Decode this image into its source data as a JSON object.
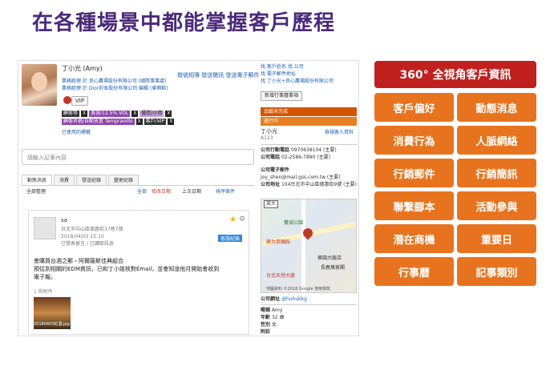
{
  "headline": "在各種場景中都能掌握客戶歷程",
  "profile": {
    "name": "丁小光 (Amy)",
    "title_line1": "業務經理 於 良心農場股份有限公司 (國際事業處)",
    "title_line2": "業務經理 於 Dior彩妝股份有限公司 編輯 (東興館)",
    "vip_label": "VIP",
    "action_links": "撥號相簿 發送簡訊 發送電子郵件",
    "tags_row1": [
      "顧客等",
      "X",
      "美容/12.5% VOL",
      "X",
      "優質/小資",
      "X"
    ],
    "tags_row2": [
      "顧客名稱/自動放置 Tempranillo",
      "X",
      "客戶/VIP",
      "X"
    ],
    "used_label": "已使用的標籤"
  },
  "right_links": [
    "找 客戶姓名  找 公司",
    "找 電子郵件地址",
    "找 丁小光+良心農場股份有限公司"
  ],
  "new_todo_label": "新增行事曆事項",
  "activity_1": "追蹤未完成",
  "activity_2": "進行中",
  "contact": {
    "name": "丁小光",
    "code": "A123",
    "edit_link": "檢視客人資料",
    "company_phone_label": "公司行動電話",
    "company_phone": "0970638104 (主要)",
    "company_tel_label": "公司電話",
    "company_tel": "02-2586-7890 (主要)",
    "email_label": "公司電子郵件",
    "email": "joy_shen@mail.gss.com.tw (主要)",
    "address_label": "公司地址",
    "address": "104台北市中山區德惠街9號 (主要)",
    "enlarge": "放大",
    "map_label_1": "雙城公園",
    "map_label_2": "樂台萊麵館",
    "map_label_3": "華園大飯店",
    "map_label_4": "長春萬客閣",
    "map_label_5": "台北天然大廈",
    "map_footer": "地圖資料 ©2018 Google  使用條款",
    "line_label": "公司網址",
    "line_value": "@huhukkg",
    "nick_label": "暱稱",
    "nick_value": "Amy",
    "age_label": "年齡",
    "age_value": "32 歲",
    "gender_label": "性別",
    "gender_value": "女",
    "note_label": "附註"
  },
  "note_placeholder": "請輸入記事內容",
  "tabs": [
    "動態消息",
    "消費",
    "發送紀錄",
    "變更紀錄"
  ],
  "feed": {
    "toolbar_left": "全部整理",
    "filter_all": "全部",
    "filter_date": "修改日期",
    "filter_type": "上次日期",
    "filter_btn": "排序條件",
    "post_author": "sa",
    "post_location": "台北市中山區德惠街37巷7號",
    "post_time": "2018/04/03 15:10",
    "post_meta": "已發表留言 / 已讀取訊息",
    "badge": "客服紀錄",
    "post_text": "會購買台酒之郵・阿爾薩斯佳典組合\n預估到相關的EDM資訊，已和丁小姐核對Email，並會知道他月開始會收到\n電子報。",
    "attach_label": "1 則附件",
    "attach_caption": "20180403紅酒.jpg"
  },
  "features": {
    "main": "360° 全視角客戶資訊",
    "items": [
      "客戶偏好",
      "動態消息",
      "消費行為",
      "人脈網絡",
      "行銷郵件",
      "行銷簡訊",
      "聯繫腳本",
      "活動參與",
      "潛在商機",
      "重要日",
      "行事曆",
      "記事類別"
    ]
  }
}
